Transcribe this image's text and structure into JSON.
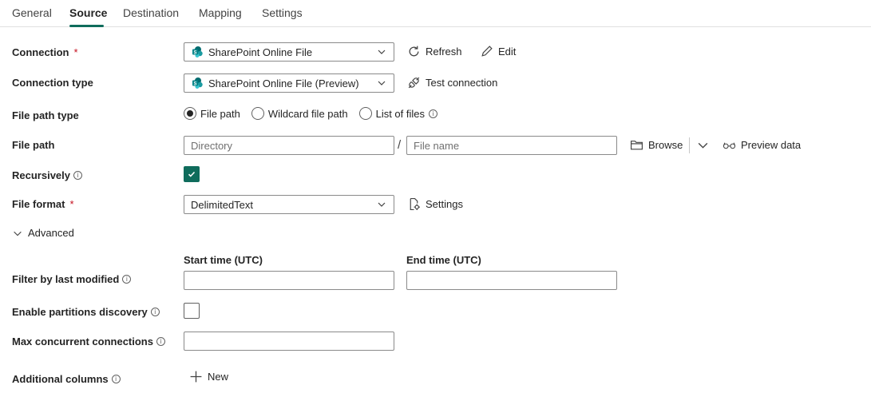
{
  "tabs": [
    "General",
    "Source",
    "Destination",
    "Mapping",
    "Settings"
  ],
  "connection": {
    "label": "Connection",
    "value": "SharePoint Online File",
    "refresh": "Refresh",
    "edit": "Edit"
  },
  "connection_type": {
    "label": "Connection type",
    "value": "SharePoint Online File (Preview)",
    "test": "Test connection"
  },
  "file_path_type": {
    "label": "File path type",
    "options": [
      "File path",
      "Wildcard file path",
      "List of files"
    ],
    "selected": "File path"
  },
  "file_path": {
    "label": "File path",
    "directory_placeholder": "Directory",
    "separator": "/",
    "filename_placeholder": "File name",
    "browse": "Browse",
    "preview": "Preview data"
  },
  "recursively": {
    "label": "Recursively",
    "checked": true
  },
  "file_format": {
    "label": "File format",
    "value": "DelimitedText",
    "settings": "Settings"
  },
  "advanced": {
    "label": "Advanced"
  },
  "filter": {
    "label": "Filter by last modified",
    "start_label": "Start time (UTC)",
    "end_label": "End time (UTC)"
  },
  "partitions": {
    "label": "Enable partitions discovery",
    "checked": false
  },
  "max_conn": {
    "label": "Max concurrent connections"
  },
  "additional_columns": {
    "label": "Additional columns",
    "new": "New"
  },
  "colors": {
    "accent": "#0f6c5c",
    "required": "#c50f1f",
    "border": "#8a8a8a"
  }
}
